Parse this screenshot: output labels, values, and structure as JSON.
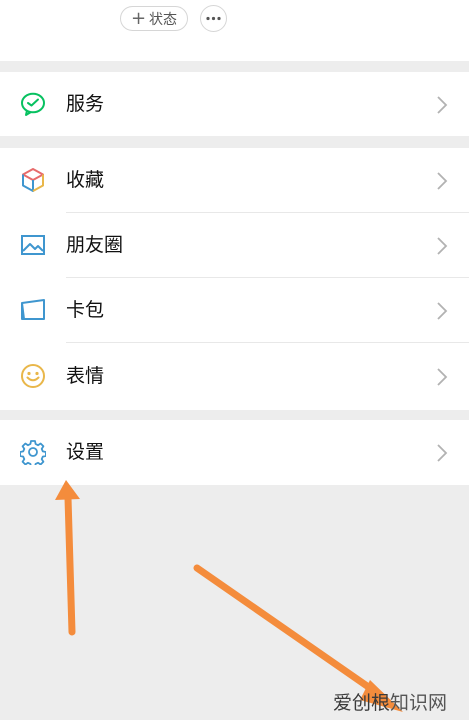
{
  "header": {
    "status_label": "状态",
    "status_plus": "+"
  },
  "menu": {
    "services": {
      "label": "服务",
      "icon": "wechat-pay-icon"
    },
    "favorites": {
      "label": "收藏",
      "icon": "cube-icon"
    },
    "moments": {
      "label": "朋友圈",
      "icon": "picture-icon"
    },
    "cards": {
      "label": "卡包",
      "icon": "card-icon"
    },
    "stickers": {
      "label": "表情",
      "icon": "smiley-icon"
    },
    "settings": {
      "label": "设置",
      "icon": "gear-icon"
    }
  },
  "watermark": {
    "part1": "爱创根",
    "part2": "知识网"
  },
  "colors": {
    "background": "#ededed",
    "row": "#ffffff",
    "annotation_arrow": "#f48c3c",
    "green": "#07c160",
    "icon_blue": "#3f96cf",
    "icon_yellow": "#e9b74a"
  }
}
